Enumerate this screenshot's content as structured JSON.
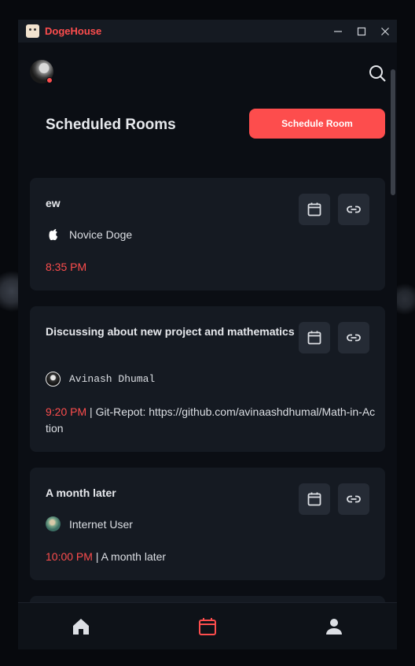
{
  "window": {
    "title": "DogeHouse"
  },
  "header": {
    "title": "Scheduled Rooms",
    "schedule_button": "Schedule Room"
  },
  "rooms": [
    {
      "title": "ew",
      "user": "Novice Doge",
      "time": "8:35 PM",
      "description": ""
    },
    {
      "title": "Discussing about new project and mathematics",
      "user": "Avinash Dhumal",
      "time": "9:20 PM",
      "description": "Git-Repot: https://github.com/avinaashdhumal/Math-in-Action"
    },
    {
      "title": "A month later",
      "user": "Internet User",
      "time": "10:00 PM",
      "description": "A month later"
    }
  ],
  "colors": {
    "accent": "#fd4d4d",
    "card": "#151a22",
    "background": "#0b0e14"
  },
  "icons": {
    "top": [
      "profile-avatar",
      "search-icon"
    ],
    "card_actions": [
      "calendar-icon",
      "link-icon"
    ],
    "nav": [
      "home-icon",
      "calendar-icon",
      "user-icon"
    ]
  }
}
